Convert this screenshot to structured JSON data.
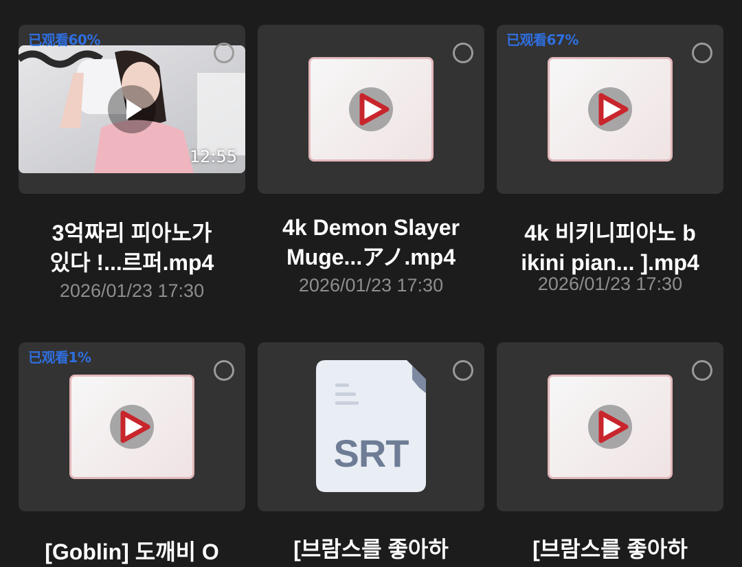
{
  "items": [
    {
      "progress": "已观看60%",
      "duration": "12:55",
      "title_line1": "3억짜리 피아노가",
      "title_line2": "있다 !...르퍼.mp4",
      "date": "2026/01/23 17:30"
    },
    {
      "progress": "",
      "title_line1": "4k Demon Slayer",
      "title_line2": "Muge...アノ.mp4",
      "date": "2026/01/23 17:30"
    },
    {
      "progress": "已观看67%",
      "title_line1": "4k 비키니피아노 b",
      "title_line2": "ikini pian... ].mp4",
      "date": "2026/01/23 17:30"
    },
    {
      "progress": "已观看1%",
      "title_line1": "[Goblin] 도깨비 O"
    },
    {
      "progress": "",
      "file_type": "SRT",
      "title_line1": "[브람스를 좋아하"
    },
    {
      "progress": "",
      "title_line1": "[브람스를 좋아하"
    }
  ],
  "icons": {
    "play": "play-icon",
    "select": "select-circle-icon",
    "video": "video-file-icon",
    "subtitle": "srt-file-icon"
  },
  "colors": {
    "background": "#1c1c1c",
    "card": "#333333",
    "progress": "#2f6fe0",
    "play_red": "#c8262c"
  }
}
